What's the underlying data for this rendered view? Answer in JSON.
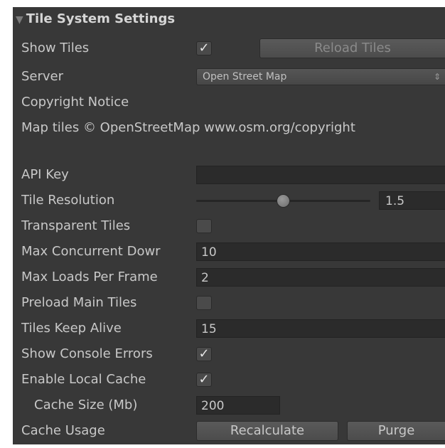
{
  "section": {
    "title": "Tile System Settings",
    "collapse_icon": "triangle-down"
  },
  "show_tiles": {
    "label": "Show Tiles",
    "checked": true,
    "reload_button": "Reload Tiles"
  },
  "server": {
    "label": "Server",
    "value": "Open Street Map",
    "arrow": "⇕"
  },
  "copyright": {
    "label": "Copyright Notice",
    "text": "Map tiles © OpenStreetMap www.osm.org/copyright"
  },
  "api_key": {
    "label": "API Key",
    "value": ""
  },
  "tile_resolution": {
    "label": "Tile Resolution",
    "value": "1.5",
    "slider_fraction": 0.5
  },
  "transparent_tiles": {
    "label": "Transparent Tiles",
    "checked": false
  },
  "max_concurrent": {
    "label": "Max Concurrent Dowr",
    "value": "10"
  },
  "max_loads": {
    "label": "Max Loads Per Frame",
    "value": "2"
  },
  "preload_main": {
    "label": "Preload Main Tiles",
    "checked": false
  },
  "tiles_keep_alive": {
    "label": "Tiles Keep Alive",
    "value": "15"
  },
  "show_console_errors": {
    "label": "Show Console Errors",
    "checked": true
  },
  "enable_local_cache": {
    "label": "Enable Local Cache",
    "checked": true
  },
  "cache_size": {
    "label": "Cache Size (Mb)",
    "value": "200"
  },
  "cache_usage": {
    "label": "Cache Usage",
    "recalculate_button": "Recalculate",
    "purge_button": "Purge"
  },
  "colors": {
    "panel_bg": "#383838",
    "field_bg": "#2b2b2b",
    "text": "#c8c8c8"
  }
}
